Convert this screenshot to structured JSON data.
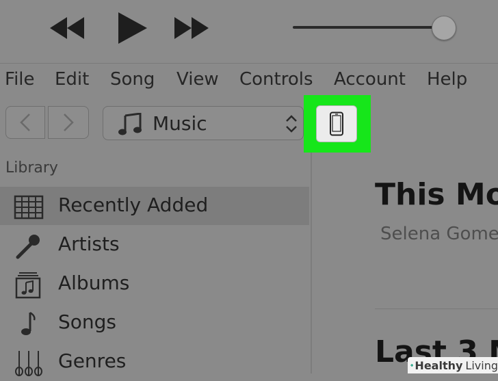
{
  "menu": {
    "items": [
      "File",
      "Edit",
      "Song",
      "View",
      "Controls",
      "Account",
      "Help"
    ]
  },
  "toolbar": {
    "library_select_label": "Music"
  },
  "sidebar": {
    "heading": "Library",
    "items": [
      {
        "label": "Recently Added",
        "icon": "grid-icon"
      },
      {
        "label": "Artists",
        "icon": "microphone-icon"
      },
      {
        "label": "Albums",
        "icon": "album-icon"
      },
      {
        "label": "Songs",
        "icon": "music-note-icon"
      },
      {
        "label": "Genres",
        "icon": "guitars-icon"
      }
    ]
  },
  "main": {
    "title": "This Mo",
    "subtitle": "Selena Gomez",
    "title2": "Last 3 M"
  },
  "volume": {
    "level": 0.92
  },
  "watermark": {
    "word1": "Healthy",
    "word2": "Living"
  },
  "colors": {
    "highlight": "#16e61a",
    "watermark_plus": "#2aa88a"
  }
}
